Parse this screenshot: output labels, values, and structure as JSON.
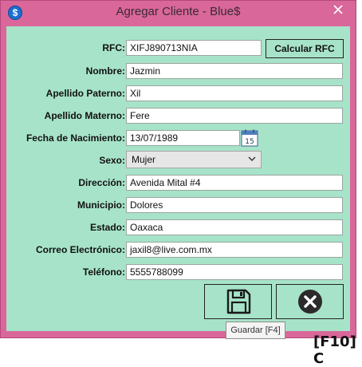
{
  "window": {
    "title": "Agregar Cliente - Blue$",
    "app_icon_glyph": "$"
  },
  "form": {
    "rfc": {
      "label": "RFC:",
      "value": "XIFJ890713NIA"
    },
    "calc_rfc_label": "Calcular RFC",
    "nombre": {
      "label": "Nombre:",
      "value": "Jazmin"
    },
    "apellido_paterno": {
      "label": "Apellido Paterno:",
      "value": "Xil"
    },
    "apellido_materno": {
      "label": "Apellido Materno:",
      "value": "Fere"
    },
    "fecha_nacimiento": {
      "label": "Fecha de Nacimiento:",
      "value": "13/07/1989",
      "calendar_day": "15"
    },
    "sexo": {
      "label": "Sexo:",
      "value": "Mujer"
    },
    "direccion": {
      "label": "Dirección:",
      "value": "Avenida Mital #4"
    },
    "municipio": {
      "label": "Municipio:",
      "value": "Dolores"
    },
    "estado": {
      "label": "Estado:",
      "value": "Oaxaca"
    },
    "correo": {
      "label": "Correo Electrónico:",
      "value": "jaxil8@live.com.mx"
    },
    "telefono": {
      "label": "Teléfono:",
      "value": "5555788099"
    }
  },
  "tooltip": "Guardar [F4]",
  "background_text": "[F10] C",
  "colors": {
    "frame": "#d9679a",
    "client": "#a7e3c9",
    "close_icon_fill": "#2b2b2b"
  },
  "icons": {
    "save": "floppy-disk-icon",
    "cancel": "close-circle-icon",
    "calendar": "calendar-icon",
    "window_close": "x-icon"
  }
}
